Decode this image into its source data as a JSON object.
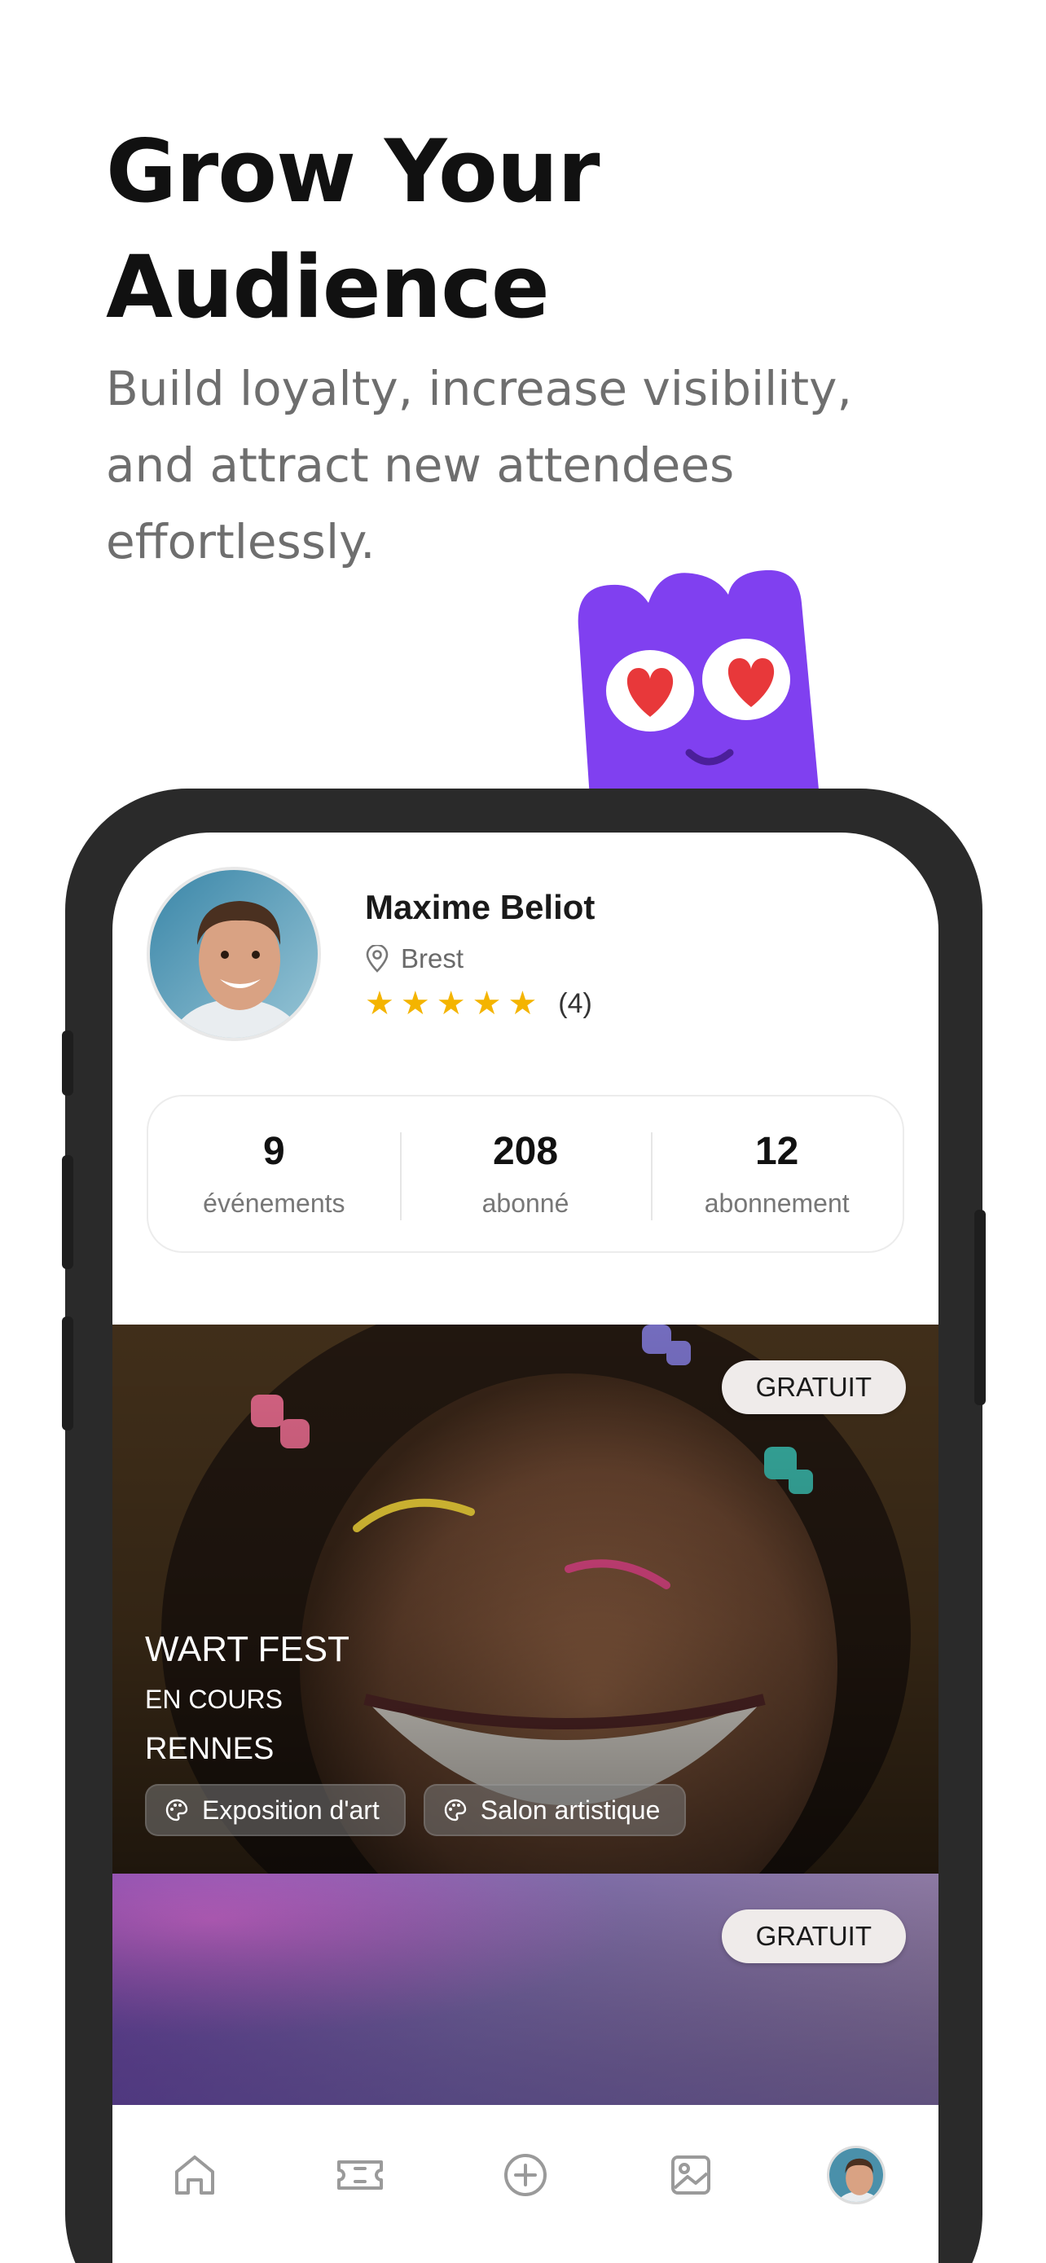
{
  "headline": {
    "title_line1": "Grow Your",
    "title_line2": "Audience",
    "subtitle": "Build loyalty, increase visibility, and attract new attendees effortlessly."
  },
  "profile": {
    "name": "Maxime Beliot",
    "location": "Brest",
    "rating_stars": 5,
    "rating_count": "(4)"
  },
  "stats": [
    {
      "value": "9",
      "label": "événements"
    },
    {
      "value": "208",
      "label": "abonné"
    },
    {
      "value": "12",
      "label": "abonnement"
    }
  ],
  "events": [
    {
      "badge": "GRATUIT",
      "title": "WART FEST",
      "status": "EN COURS",
      "city": "RENNES",
      "tags": [
        "Exposition d'art",
        "Salon artistique"
      ]
    },
    {
      "badge": "GRATUIT"
    }
  ],
  "nav": {
    "items": [
      "home-icon",
      "ticket-icon",
      "add-circle-icon",
      "image-icon",
      "profile-avatar"
    ]
  },
  "colors": {
    "mascot": "#8040f0",
    "star": "#f4b400",
    "phone_frame": "#2a2a2a"
  }
}
